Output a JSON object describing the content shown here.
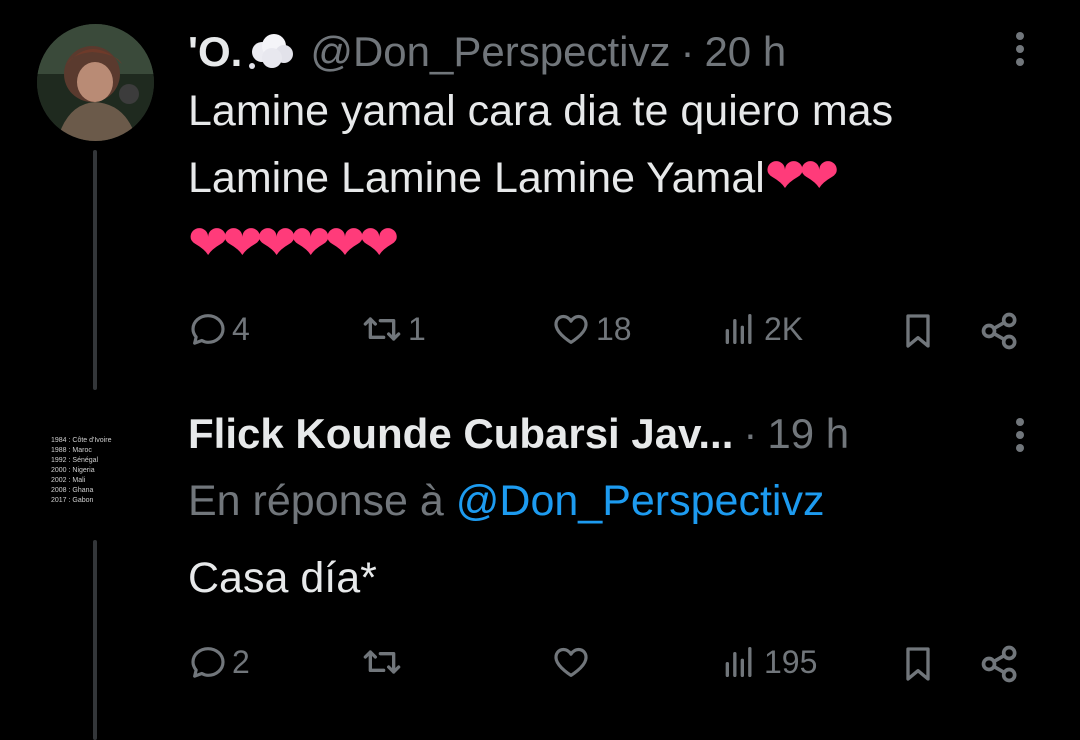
{
  "tweet1": {
    "display_name": "'O.",
    "handle": "@Don_Perspectivz",
    "separator": "·",
    "time": "20 h",
    "line1": "Lamine yamal cara dia te quiero mas",
    "line2": "Lamine Lamine Lamine Yamal",
    "hearts_inline": "❤❤",
    "hearts_row": "❤❤❤❤❤❤",
    "replies": "4",
    "reposts": "1",
    "likes": "18",
    "views": "2K"
  },
  "tweet2": {
    "display_name": "Flick Kounde Cubarsi Jav...",
    "separator": "·",
    "time": "19 h",
    "reply_prefix": "En réponse à",
    "reply_to": "@Don_Perspectivz",
    "text": "Casa día*",
    "replies": "2",
    "reposts": "",
    "likes": "",
    "views": "195",
    "avatar_lines": [
      "1984 : Côte d'Ivoire",
      "1988 : Maroc",
      "1992 : Sénégal",
      "2000 : Nigeria",
      "2002 : Mali",
      "2008 : Ghana",
      "2017 : Gabon"
    ]
  },
  "colors": {
    "background": "#000000",
    "text": "#e7e9ea",
    "muted": "#71767b",
    "link": "#1d9bf0",
    "heart": "#ff3b7a"
  }
}
